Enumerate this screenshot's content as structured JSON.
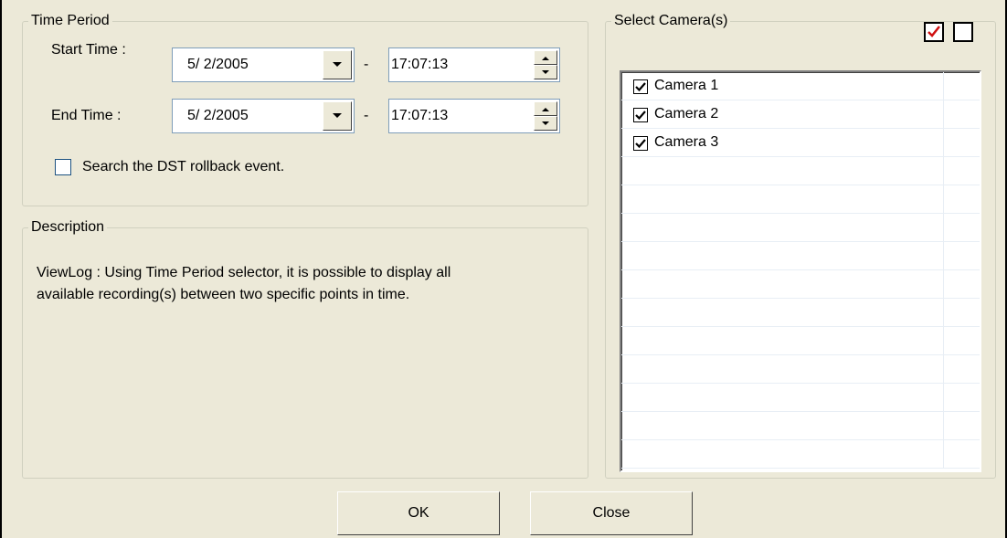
{
  "time_period": {
    "legend": "Time Period",
    "start_label": "Start Time :",
    "start_date": "5/  2/2005",
    "start_time": "17:07:13",
    "end_label": "End Time :",
    "end_date": "5/  2/2005",
    "end_time": "17:07:13",
    "separator": "-",
    "dst_label": "Search the DST rollback event.",
    "dst_checked": false
  },
  "description": {
    "legend": "Description",
    "text_line1": "ViewLog : Using Time Period selector, it is possible to display all",
    "text_line2": "available recording(s) between two specific points in time."
  },
  "cameras": {
    "legend": "Select Camera(s)",
    "select_all_icon": "check-all-icon",
    "select_none_icon": "uncheck-all-icon",
    "items": [
      {
        "label": "Camera 1",
        "checked": true
      },
      {
        "label": "Camera 2",
        "checked": true
      },
      {
        "label": "Camera 3",
        "checked": true
      }
    ]
  },
  "buttons": {
    "ok": "OK",
    "close": "Close"
  }
}
